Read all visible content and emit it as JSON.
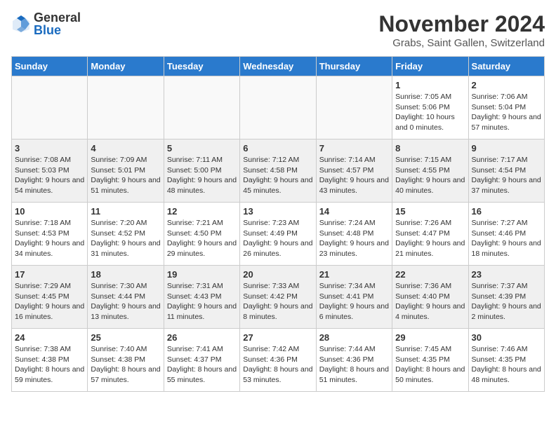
{
  "logo": {
    "general": "General",
    "blue": "Blue"
  },
  "header": {
    "month": "November 2024",
    "location": "Grabs, Saint Gallen, Switzerland"
  },
  "weekdays": [
    "Sunday",
    "Monday",
    "Tuesday",
    "Wednesday",
    "Thursday",
    "Friday",
    "Saturday"
  ],
  "weeks": [
    [
      {
        "day": "",
        "info": ""
      },
      {
        "day": "",
        "info": ""
      },
      {
        "day": "",
        "info": ""
      },
      {
        "day": "",
        "info": ""
      },
      {
        "day": "",
        "info": ""
      },
      {
        "day": "1",
        "info": "Sunrise: 7:05 AM\nSunset: 5:06 PM\nDaylight: 10 hours and 0 minutes."
      },
      {
        "day": "2",
        "info": "Sunrise: 7:06 AM\nSunset: 5:04 PM\nDaylight: 9 hours and 57 minutes."
      }
    ],
    [
      {
        "day": "3",
        "info": "Sunrise: 7:08 AM\nSunset: 5:03 PM\nDaylight: 9 hours and 54 minutes."
      },
      {
        "day": "4",
        "info": "Sunrise: 7:09 AM\nSunset: 5:01 PM\nDaylight: 9 hours and 51 minutes."
      },
      {
        "day": "5",
        "info": "Sunrise: 7:11 AM\nSunset: 5:00 PM\nDaylight: 9 hours and 48 minutes."
      },
      {
        "day": "6",
        "info": "Sunrise: 7:12 AM\nSunset: 4:58 PM\nDaylight: 9 hours and 45 minutes."
      },
      {
        "day": "7",
        "info": "Sunrise: 7:14 AM\nSunset: 4:57 PM\nDaylight: 9 hours and 43 minutes."
      },
      {
        "day": "8",
        "info": "Sunrise: 7:15 AM\nSunset: 4:55 PM\nDaylight: 9 hours and 40 minutes."
      },
      {
        "day": "9",
        "info": "Sunrise: 7:17 AM\nSunset: 4:54 PM\nDaylight: 9 hours and 37 minutes."
      }
    ],
    [
      {
        "day": "10",
        "info": "Sunrise: 7:18 AM\nSunset: 4:53 PM\nDaylight: 9 hours and 34 minutes."
      },
      {
        "day": "11",
        "info": "Sunrise: 7:20 AM\nSunset: 4:52 PM\nDaylight: 9 hours and 31 minutes."
      },
      {
        "day": "12",
        "info": "Sunrise: 7:21 AM\nSunset: 4:50 PM\nDaylight: 9 hours and 29 minutes."
      },
      {
        "day": "13",
        "info": "Sunrise: 7:23 AM\nSunset: 4:49 PM\nDaylight: 9 hours and 26 minutes."
      },
      {
        "day": "14",
        "info": "Sunrise: 7:24 AM\nSunset: 4:48 PM\nDaylight: 9 hours and 23 minutes."
      },
      {
        "day": "15",
        "info": "Sunrise: 7:26 AM\nSunset: 4:47 PM\nDaylight: 9 hours and 21 minutes."
      },
      {
        "day": "16",
        "info": "Sunrise: 7:27 AM\nSunset: 4:46 PM\nDaylight: 9 hours and 18 minutes."
      }
    ],
    [
      {
        "day": "17",
        "info": "Sunrise: 7:29 AM\nSunset: 4:45 PM\nDaylight: 9 hours and 16 minutes."
      },
      {
        "day": "18",
        "info": "Sunrise: 7:30 AM\nSunset: 4:44 PM\nDaylight: 9 hours and 13 minutes."
      },
      {
        "day": "19",
        "info": "Sunrise: 7:31 AM\nSunset: 4:43 PM\nDaylight: 9 hours and 11 minutes."
      },
      {
        "day": "20",
        "info": "Sunrise: 7:33 AM\nSunset: 4:42 PM\nDaylight: 9 hours and 8 minutes."
      },
      {
        "day": "21",
        "info": "Sunrise: 7:34 AM\nSunset: 4:41 PM\nDaylight: 9 hours and 6 minutes."
      },
      {
        "day": "22",
        "info": "Sunrise: 7:36 AM\nSunset: 4:40 PM\nDaylight: 9 hours and 4 minutes."
      },
      {
        "day": "23",
        "info": "Sunrise: 7:37 AM\nSunset: 4:39 PM\nDaylight: 9 hours and 2 minutes."
      }
    ],
    [
      {
        "day": "24",
        "info": "Sunrise: 7:38 AM\nSunset: 4:38 PM\nDaylight: 8 hours and 59 minutes."
      },
      {
        "day": "25",
        "info": "Sunrise: 7:40 AM\nSunset: 4:38 PM\nDaylight: 8 hours and 57 minutes."
      },
      {
        "day": "26",
        "info": "Sunrise: 7:41 AM\nSunset: 4:37 PM\nDaylight: 8 hours and 55 minutes."
      },
      {
        "day": "27",
        "info": "Sunrise: 7:42 AM\nSunset: 4:36 PM\nDaylight: 8 hours and 53 minutes."
      },
      {
        "day": "28",
        "info": "Sunrise: 7:44 AM\nSunset: 4:36 PM\nDaylight: 8 hours and 51 minutes."
      },
      {
        "day": "29",
        "info": "Sunrise: 7:45 AM\nSunset: 4:35 PM\nDaylight: 8 hours and 50 minutes."
      },
      {
        "day": "30",
        "info": "Sunrise: 7:46 AM\nSunset: 4:35 PM\nDaylight: 8 hours and 48 minutes."
      }
    ]
  ]
}
